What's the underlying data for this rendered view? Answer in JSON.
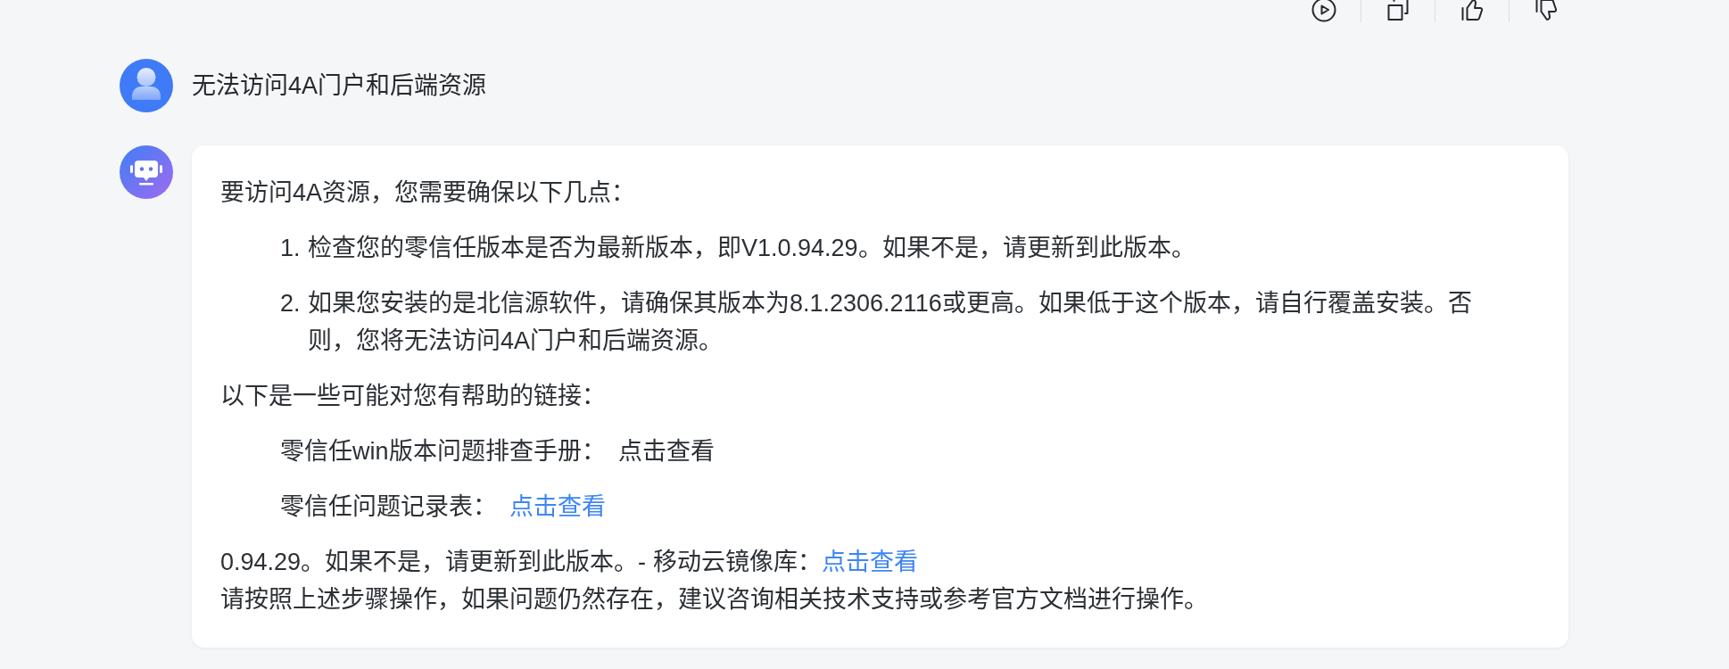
{
  "conversation": [
    {
      "kind": "user",
      "text": "无法访问4A门户和后端资源"
    },
    {
      "kind": "assistant",
      "blocks": [
        {
          "kind": "paragraph",
          "lines": [
            [
              {
                "text": "要访问4A资源，您需要确保以下几点：",
                "link": false
              }
            ]
          ]
        },
        {
          "kind": "ordered_list",
          "items": [
            {
              "marker": "1.",
              "text": "检查您的零信任版本是否为最新版本，即V1.0.94.29。如果不是，请更新到此版本。"
            },
            {
              "marker": "2.",
              "text": "如果您安装的是北信源软件，请确保其版本为8.1.2306.2116或更高。如果低于这个版本，请自行覆盖安装。否则，您将无法访问4A门户和后端资源。"
            }
          ]
        },
        {
          "kind": "paragraph",
          "lines": [
            [
              {
                "text": "以下是一些可能对您有帮助的链接：",
                "link": false
              }
            ]
          ]
        },
        {
          "kind": "link_row",
          "lines": [
            [
              {
                "text": "零信任win版本问题排查手册：",
                "link": false
              },
              {
                "text": "点击查看",
                "link": false
              }
            ]
          ]
        },
        {
          "kind": "link_row",
          "lines": [
            [
              {
                "text": "零信任问题记录表：",
                "link": false
              },
              {
                "text": "点击查看",
                "link": true
              }
            ]
          ]
        },
        {
          "kind": "paragraph",
          "lines": [
            [
              {
                "text": "0.94.29。如果不是，请更新到此版本。- 移动云镜像库：",
                "link": false
              },
              {
                "text": "点击查看",
                "link": true
              }
            ],
            [
              {
                "text": "请按照上述步骤操作，如果问题仍然存在，建议咨询相关技术支持或参考官方文档进行操作。",
                "link": false
              }
            ]
          ]
        }
      ]
    }
  ]
}
